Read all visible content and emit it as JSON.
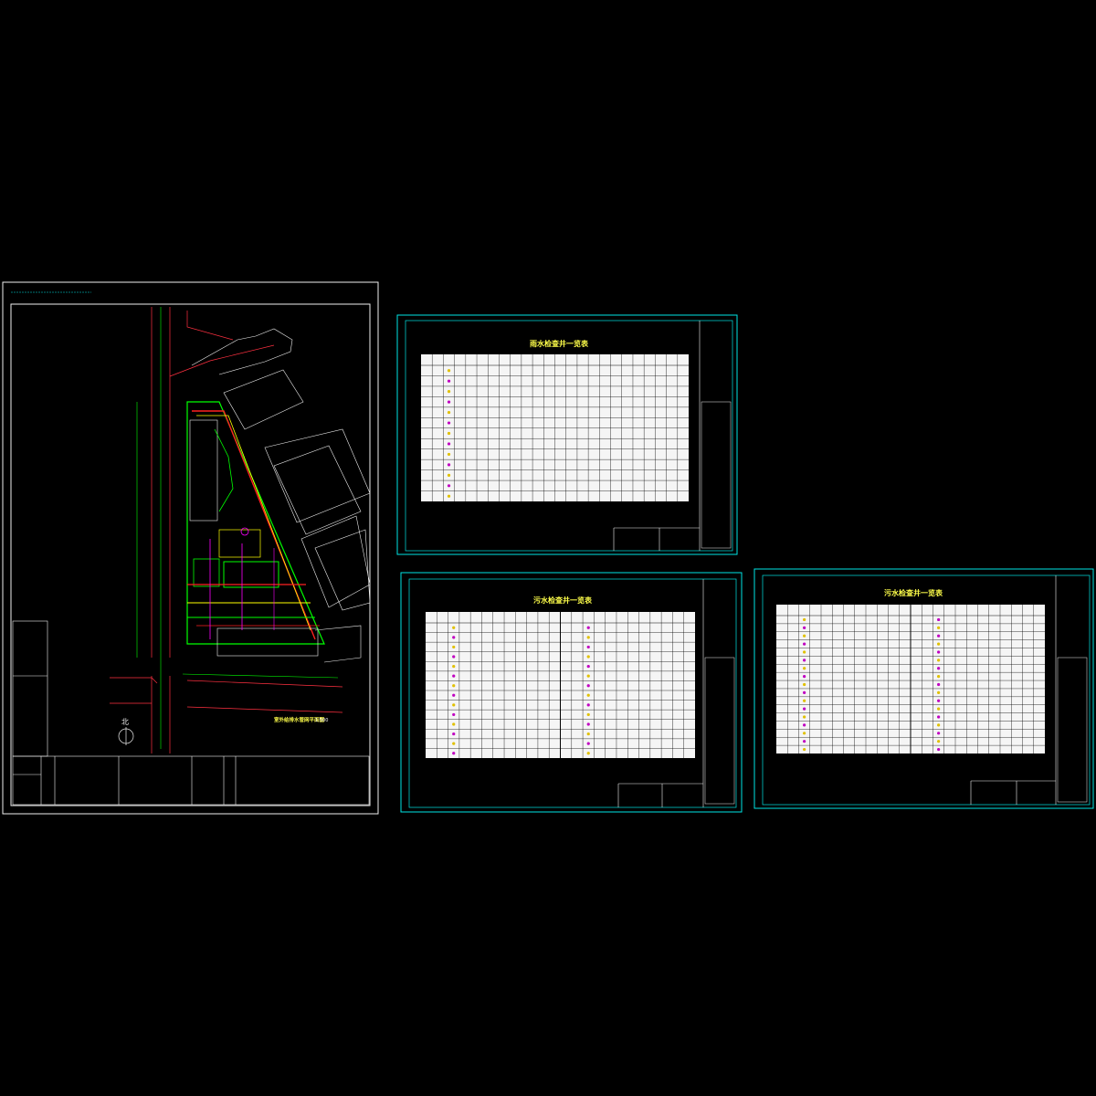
{
  "drawing": {
    "site_plan": {
      "title": "室外给排水管网平面图",
      "scale": "1:500",
      "north_label": "北"
    },
    "sheets": [
      {
        "id": "storm",
        "title": "雨水检查井一览表",
        "rows": 13,
        "has_right_block": false
      },
      {
        "id": "sewage_1",
        "title": "污水检查井一览表",
        "rows": 14,
        "has_right_block": true
      },
      {
        "id": "sewage_2",
        "title": "污水检查井一览表",
        "rows": 17,
        "has_right_block": true
      }
    ]
  },
  "colors": {
    "background": "#000000",
    "frame": "#00e5e5",
    "table_lines": "#000000",
    "title": "#ffff4a",
    "pipe_red": "#ff2020",
    "pipe_green": "#00ff00",
    "pipe_yellow": "#ffff00",
    "pipe_magenta": "#ff00ff",
    "road": "#ff3040"
  }
}
